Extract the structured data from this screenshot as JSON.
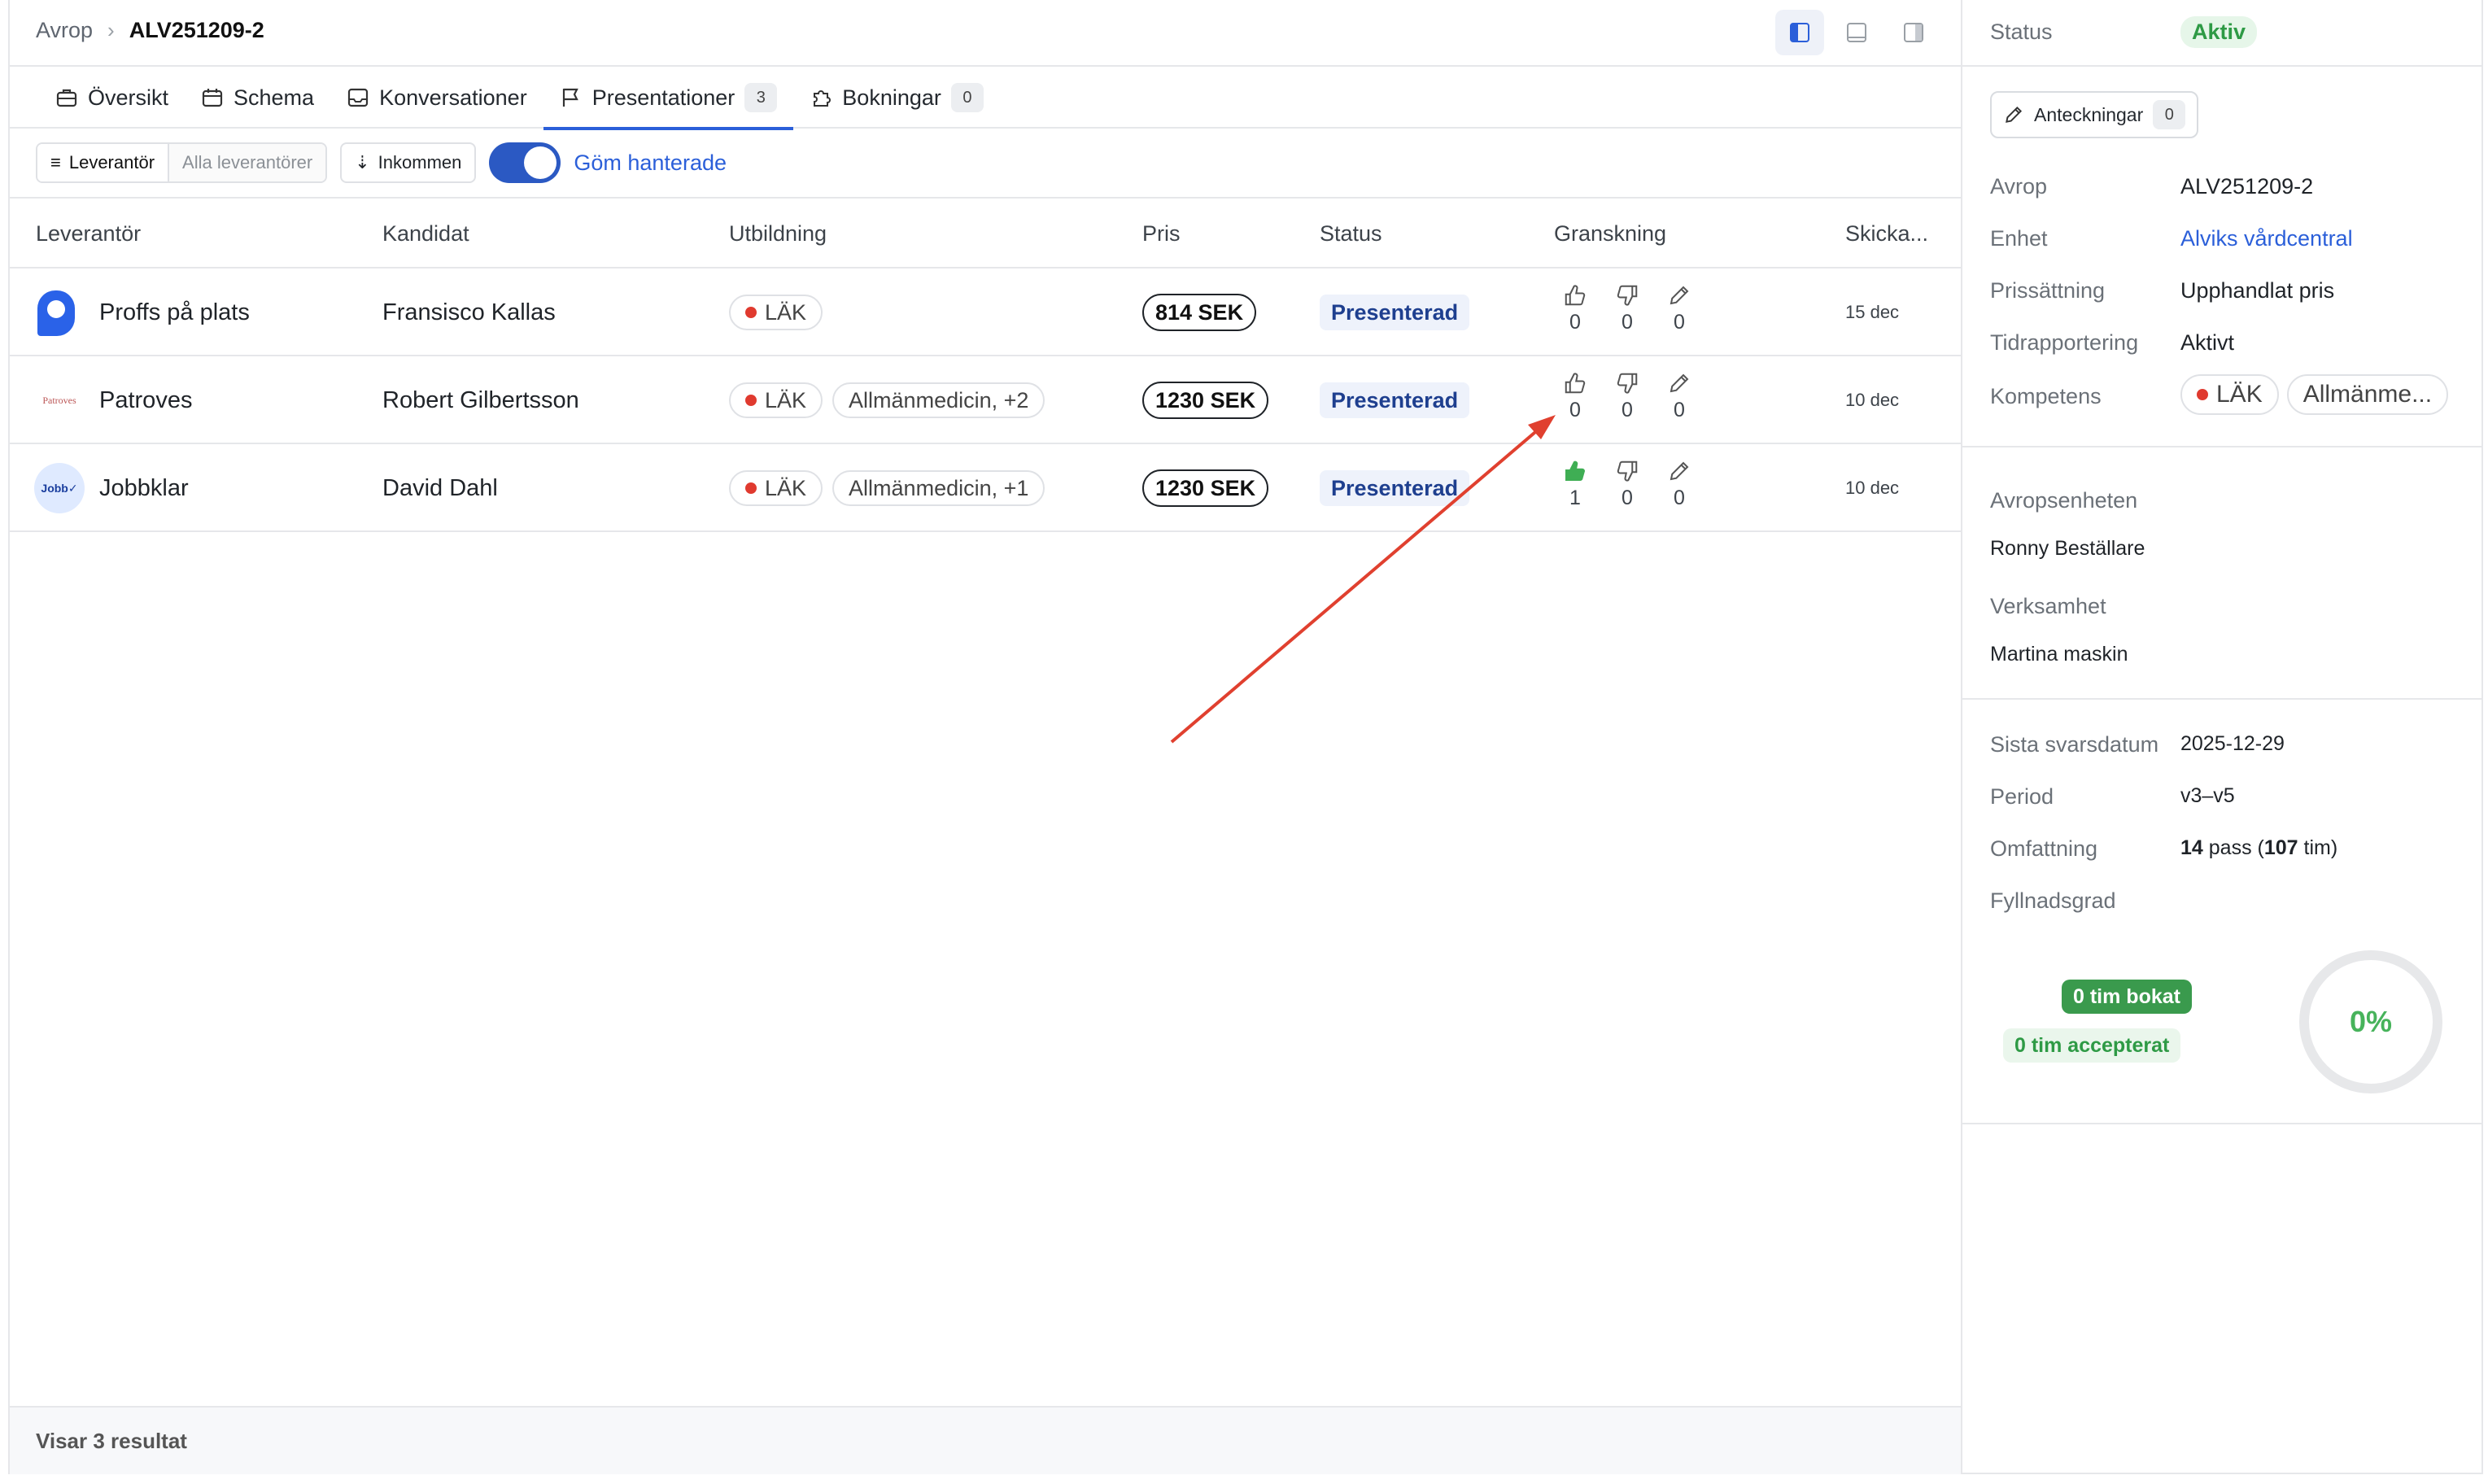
{
  "breadcrumb": {
    "root": "Avrop",
    "current": "ALV251209-2"
  },
  "tabs": [
    {
      "label": "Översikt",
      "icon": "briefcase-icon"
    },
    {
      "label": "Schema",
      "icon": "calendar-icon"
    },
    {
      "label": "Konversationer",
      "icon": "inbox-icon"
    },
    {
      "label": "Presentationer",
      "icon": "flag-icon",
      "count": "3"
    },
    {
      "label": "Bokningar",
      "icon": "puzzle-icon",
      "count": "0"
    }
  ],
  "filters": {
    "supplier_on": "Leverantör",
    "supplier_off": "Alla leverantörer",
    "sort": "Inkommen",
    "toggle_label": "Göm hanterade"
  },
  "table": {
    "headers": [
      "Leverantör",
      "Kandidat",
      "Utbildning",
      "Pris",
      "Status",
      "Granskning",
      "Skicka..."
    ],
    "rows": [
      {
        "supplier": "Proffs på plats",
        "logo": "Proffs-logo",
        "candidate": "Fransisco Kallas",
        "edu": "LÄK",
        "extra": "",
        "price": "814 SEK",
        "status": "Presenterad",
        "up": "0",
        "down": "0",
        "edit": "0",
        "date": "15 dec"
      },
      {
        "supplier": "Patroves",
        "logo": "Patroves",
        "candidate": "Robert Gilbertsson",
        "edu": "LÄK",
        "extra": "Allmänmedicin, +2",
        "price": "1230 SEK",
        "status": "Presenterad",
        "up": "0",
        "down": "0",
        "edit": "0",
        "date": "10 dec"
      },
      {
        "supplier": "Jobbklar",
        "logo": "Jobb✓",
        "candidate": "David Dahl",
        "edu": "LÄK",
        "extra": "Allmänmedicin, +1",
        "price": "1230 SEK",
        "status": "Presenterad",
        "up": "1",
        "down": "0",
        "edit": "0",
        "date": "10 dec"
      }
    ]
  },
  "footer": "Visar 3 resultat",
  "side": {
    "status_label": "Status",
    "status_value": "Aktiv",
    "notes_label": "Anteckningar",
    "notes_count": "0",
    "avrop_label": "Avrop",
    "avrop_value": "ALV251209-2",
    "enhet_label": "Enhet",
    "enhet_value": "Alviks vårdcentral",
    "pris_label": "Prissättning",
    "pris_value": "Upphandlat pris",
    "tid_label": "Tidrapportering",
    "tid_value": "Aktivt",
    "komp_label": "Kompetens",
    "komp_chip1": "LÄK",
    "komp_chip2": "Allmänme...",
    "avropsenhet_label": "Avropsenheten",
    "avropsenhet_value": "Ronny Beställare",
    "verksamhet_label": "Verksamhet",
    "verksamhet_value": "Martina maskin",
    "svar_label": "Sista svarsdatum",
    "svar_value": "2025-12-29",
    "period_label": "Period",
    "period_value": "v3–v5",
    "omf_label": "Omfattning",
    "omf_pass": "14",
    "omf_pass_word": " pass (",
    "omf_tim": "107",
    "omf_tim_word": " tim)",
    "fyll_label": "Fyllnadsgrad",
    "booked": "0 tim bokat",
    "accepted": "0 tim accepterat",
    "gauge": "0%"
  },
  "colors": {
    "accent": "#2b5fd9",
    "green": "#3a9a4d",
    "annotation_arrow": "#e0402f"
  }
}
